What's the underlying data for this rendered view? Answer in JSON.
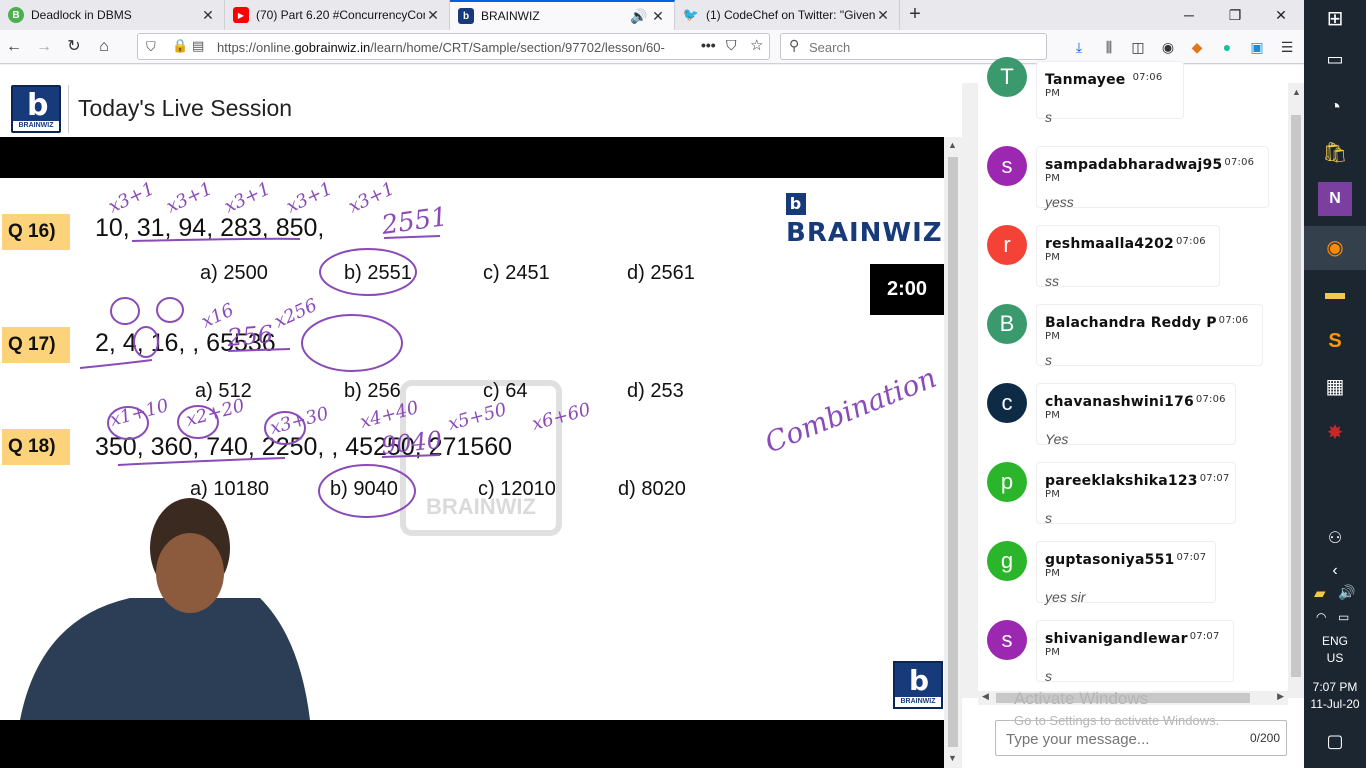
{
  "tabs": [
    {
      "title": "Deadlock in DBMS",
      "fav": "B",
      "color": "#4caf50"
    },
    {
      "title": "(70) Part 6.20 #ConcurrencyCon",
      "fav": "▶",
      "color": "#ff0000"
    },
    {
      "title": "BRAINWIZ",
      "fav": "b",
      "color": "#173a7a"
    },
    {
      "title": "(1) CodeChef on Twitter: \"Given",
      "fav": "🐦",
      "color": "#1da1f2"
    }
  ],
  "url": {
    "prefix": "https://online.",
    "domain": "gobrainwiz.in",
    "path": "/learn/home/CRT/Sample/section/97702/lesson/60-"
  },
  "search": {
    "placeholder": "Search"
  },
  "header": {
    "title": "Today's Live Session",
    "logo_label": "BRAINWIZ"
  },
  "slide": {
    "brand": "BRAINWIZ",
    "timer": "2:00",
    "watermark": "BRAINWIZ",
    "questions": [
      {
        "label": "Q 16)",
        "sequence": "10,  31,  94,  283,  850,",
        "options": [
          "a) 2500",
          "b) 2551",
          "c) 2451",
          "d) 2561"
        ]
      },
      {
        "label": "Q 17)",
        "sequence": "2,  4,  16,          ,  65536",
        "options": [
          "a) 512",
          "b) 256",
          "c) 64",
          "d) 253"
        ]
      },
      {
        "label": "Q 18)",
        "sequence": "350,  360,  740,  2250,          ,  45250,  271560",
        "options": [
          "a) 10180",
          "b) 9040",
          "c) 12010",
          "d) 8020"
        ]
      }
    ],
    "annotations": {
      "q16_answer": "2551",
      "q17_fill": "256",
      "q18_fill": "9040",
      "side_note": "Combination"
    }
  },
  "chat": {
    "messages": [
      {
        "initial": "T",
        "user": "Tanmayee",
        "time": "07:06 PM",
        "text": "s",
        "color": "#3a9a6e"
      },
      {
        "initial": "s",
        "user": "sampadabharadwaj95",
        "time": "07:06 PM",
        "text": "yess",
        "color": "#9c27b0"
      },
      {
        "initial": "r",
        "user": "reshmaalla4202",
        "time": "07:06 PM",
        "text": "ss",
        "color": "#f44336"
      },
      {
        "initial": "B",
        "user": "Balachandra Reddy P",
        "time": "07:06 PM",
        "text": "s",
        "color": "#3a9a6e"
      },
      {
        "initial": "c",
        "user": "chavanashwini176",
        "time": "07:06 PM",
        "text": "Yes",
        "color": "#0d2b45"
      },
      {
        "initial": "p",
        "user": "pareeklakshika123",
        "time": "07:07 PM",
        "text": "s",
        "color": "#2ab52a"
      },
      {
        "initial": "g",
        "user": "guptasoniya551",
        "time": "07:07 PM",
        "text": "yes sir",
        "color": "#2ab52a"
      },
      {
        "initial": "s",
        "user": "shivanigandlewar",
        "time": "07:07 PM",
        "text": "s",
        "color": "#9c27b0"
      }
    ],
    "activate_title": "Activate Windows",
    "activate_sub": "Go to Settings to activate Windows.",
    "input_placeholder": "Type your message...",
    "counter": "0/200"
  },
  "taskbar": {
    "lang1": "ENG",
    "lang2": "US",
    "time": "7:07 PM",
    "date": "11-Jul-20"
  }
}
